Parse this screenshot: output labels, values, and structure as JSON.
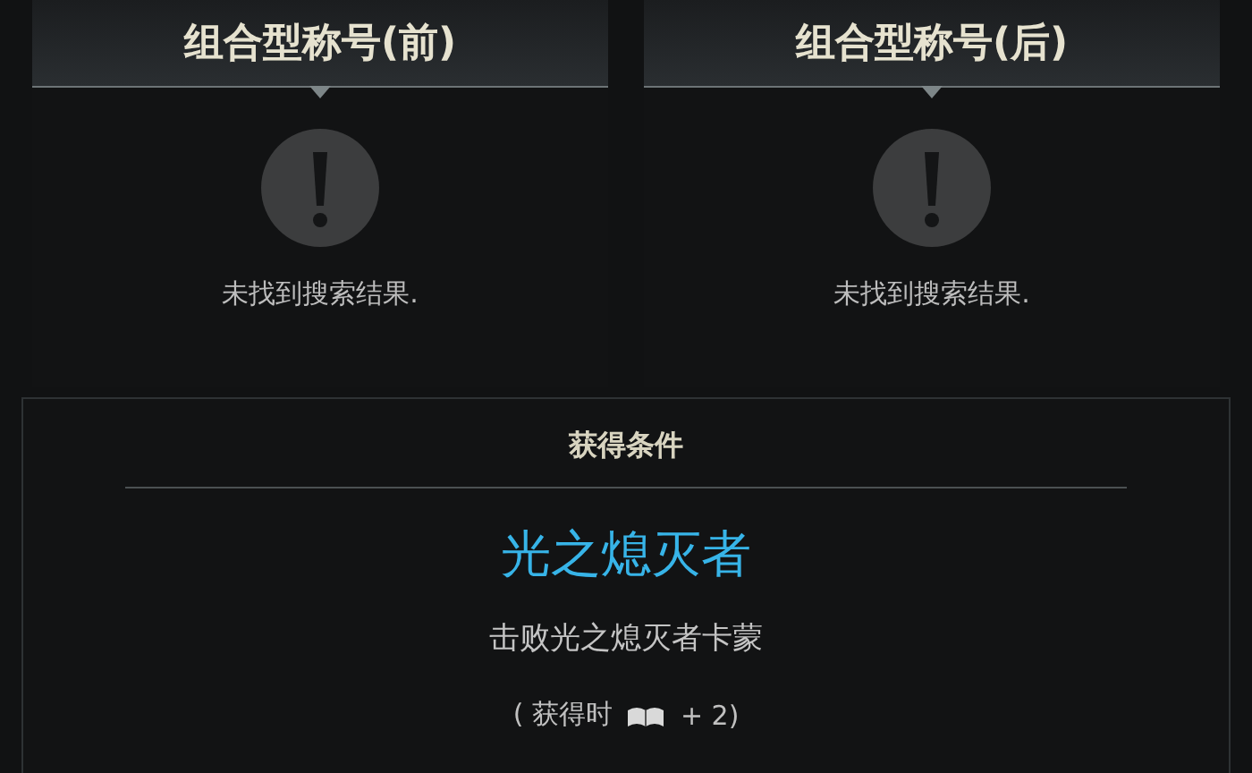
{
  "panels": [
    {
      "title": "组合型称号(前)",
      "message": "未找到搜索结果."
    },
    {
      "title": "组合型称号(后)",
      "message": "未找到搜索结果."
    }
  ],
  "condition": {
    "heading": "获得条件",
    "name": "光之熄灭者",
    "description": "击败光之熄灭者卡蒙",
    "reward_prefix": "( 获得时",
    "reward_suffix": "+ 2)"
  }
}
